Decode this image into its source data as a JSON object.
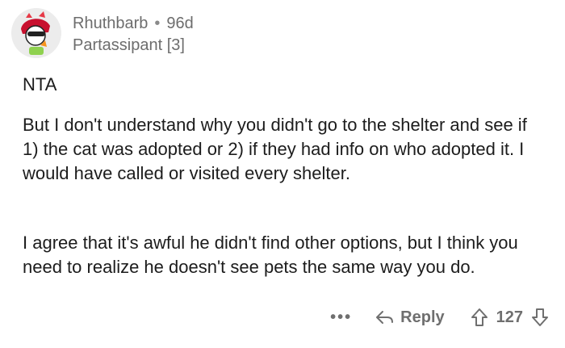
{
  "comment": {
    "author": "Rhuthbarb",
    "age": "96d",
    "separator": "•",
    "flair": "Partassipant [3]",
    "verdict": "NTA",
    "paragraphs": [
      "But I don't understand why you didn't go to the shelter and see if 1) the cat was adopted or 2) if they had info on who adopted it. I would have called or visited every shelter.",
      "I agree that it's awful he didn't find other options, but I think you need to realize he doesn't see pets the same way you do."
    ]
  },
  "actions": {
    "more_label": "•••",
    "reply_label": "Reply",
    "score": "127"
  },
  "icons": {
    "avatar": "avatar-icon",
    "more": "more-options-icon",
    "reply": "reply-arrow-icon",
    "upvote": "upvote-arrow-icon",
    "downvote": "downvote-arrow-icon"
  },
  "colors": {
    "text": "#1c1c1c",
    "meta": "#6d6d6d",
    "actions": "#6f6f6f"
  }
}
